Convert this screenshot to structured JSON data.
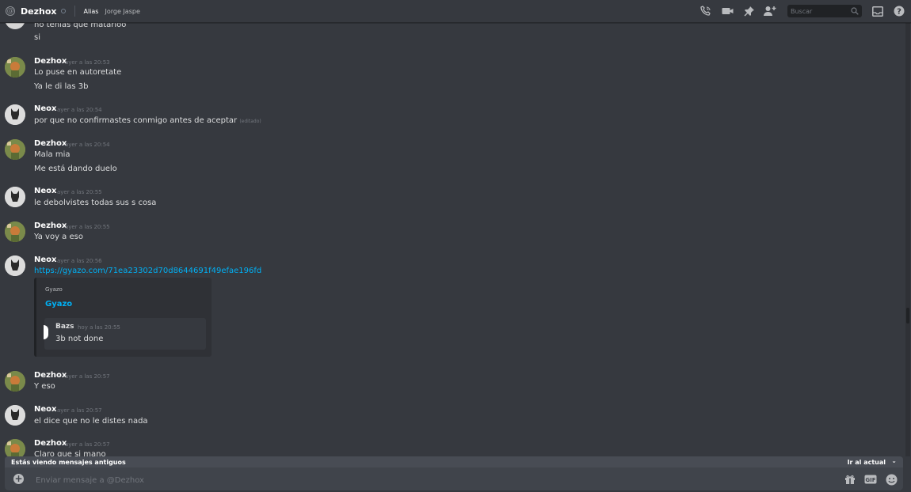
{
  "header": {
    "channel_name": "Dezhox",
    "alias_label": "Alias",
    "alias_value": "Jorge Jaspe",
    "search_placeholder": "Buscar",
    "icons": [
      "at-icon",
      "status-icon",
      "call-icon",
      "video-icon",
      "pin-icon",
      "add-friend-icon",
      "search-icon",
      "inbox-icon",
      "help-icon"
    ]
  },
  "messages": [
    {
      "author": "",
      "timestamp": "",
      "lines": [
        "no tenías que matarloo",
        "si"
      ]
    },
    {
      "author": "Dezhox",
      "timestamp": "ayer a las 20:53",
      "lines": [
        "Lo puse en autoretate",
        "Ya le di las 3b"
      ]
    },
    {
      "author": "Neox",
      "timestamp": "ayer a las 20:54",
      "lines": [
        "por que no confirmastes conmigo antes de aceptar"
      ],
      "edited": "(editado)"
    },
    {
      "author": "Dezhox",
      "timestamp": "ayer a las 20:54",
      "lines": [
        "Mala mia",
        "Me está dando duelo"
      ]
    },
    {
      "author": "Neox",
      "timestamp": "ayer a las 20:55",
      "lines": [
        "le debolvistes todas sus s cosa"
      ]
    },
    {
      "author": "Dezhox",
      "timestamp": "ayer a las 20:55",
      "lines": [
        "Ya voy a eso"
      ]
    },
    {
      "author": "Neox",
      "timestamp": "ayer a las 20:56",
      "lines": [
        "https://gyazo.com/71ea23302d70d8644691f49efae196fd"
      ],
      "embed": {
        "provider": "Gyazo",
        "title": "Gyazo",
        "card_name": "Bazs",
        "card_timestamp": "hoy a las 20:55",
        "card_text": "3b not done"
      }
    },
    {
      "author": "Dezhox",
      "timestamp": "ayer a las 20:57",
      "lines": [
        "Y eso"
      ]
    },
    {
      "author": "Neox",
      "timestamp": "ayer a las 20:57",
      "lines": [
        "el dice que no le distes nada"
      ]
    },
    {
      "author": "Dezhox",
      "timestamp": "ayer a las 20:57",
      "lines": [
        "Claro que si mano"
      ]
    }
  ],
  "banner": {
    "old_messages": "Estás viendo mensajes antiguos",
    "jump_label": "Ir al actual"
  },
  "composer": {
    "placeholder": "Enviar mensaje a @Dezhox",
    "icons": [
      "add-icon",
      "gift-icon",
      "gif-icon",
      "emoji-icon"
    ]
  },
  "colors": {
    "background": "#36393f",
    "link": "#00b0f4",
    "composer": "#40444b"
  }
}
